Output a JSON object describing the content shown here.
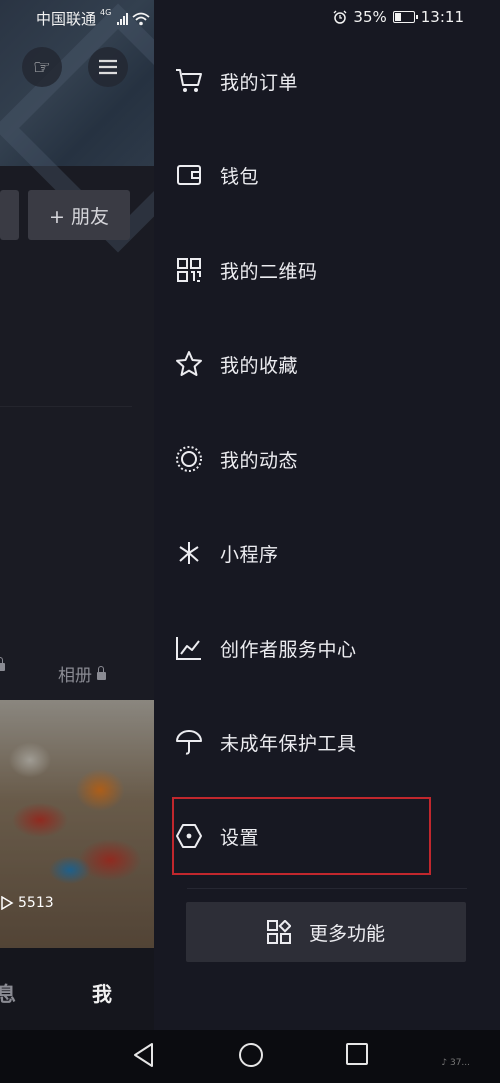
{
  "status_bar": {
    "carrier": "中国联通",
    "network": "4G",
    "battery_percent": "35%",
    "time": "13:11"
  },
  "background_page": {
    "friends_button": "+ 朋友",
    "album_tab": "相册",
    "video_views": "5513",
    "tab_messages": "息",
    "tab_me": "我"
  },
  "drawer": {
    "items": [
      {
        "label": "我的订单",
        "icon": "cart-icon"
      },
      {
        "label": "钱包",
        "icon": "wallet-icon"
      },
      {
        "label": "我的二维码",
        "icon": "qr-code-icon"
      },
      {
        "label": "我的收藏",
        "icon": "star-icon"
      },
      {
        "label": "我的动态",
        "icon": "moments-icon"
      },
      {
        "label": "小程序",
        "icon": "mini-program-icon"
      },
      {
        "label": "创作者服务中心",
        "icon": "chart-icon"
      },
      {
        "label": "未成年保护工具",
        "icon": "umbrella-icon"
      },
      {
        "label": "设置",
        "icon": "settings-hexagon-icon"
      }
    ],
    "more_button": "更多功能",
    "highlight_color": "#c1272d"
  },
  "watermark": "♪ 37..."
}
